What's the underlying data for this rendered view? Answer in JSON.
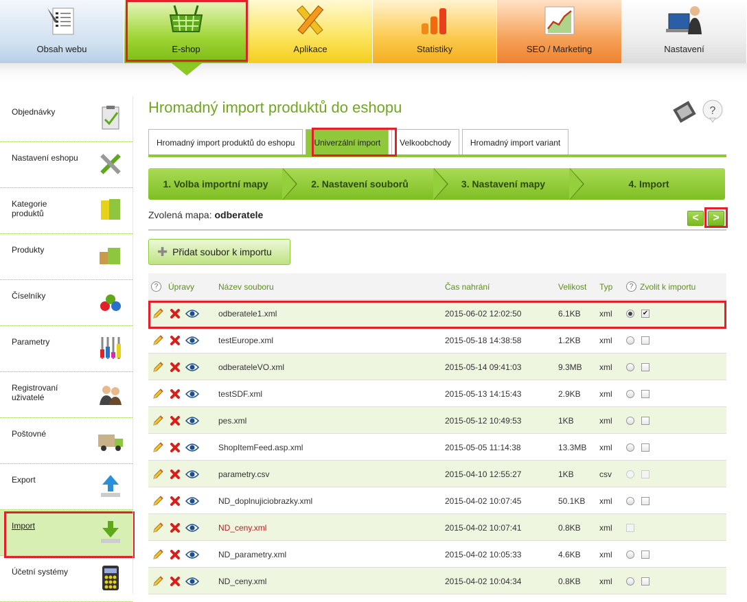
{
  "topnav": {
    "items": [
      {
        "label": "Obsah webu"
      },
      {
        "label": "E-shop"
      },
      {
        "label": "Aplikace"
      },
      {
        "label": "Statistiky"
      },
      {
        "label": "SEO / Marketing"
      },
      {
        "label": "Nastavení"
      }
    ]
  },
  "sidebar": {
    "items": [
      {
        "label": "Objednávky"
      },
      {
        "label": "Nastavení eshopu"
      },
      {
        "label": "Kategorie produktů"
      },
      {
        "label": "Produkty"
      },
      {
        "label": "Číselníky"
      },
      {
        "label": "Parametry"
      },
      {
        "label": "Registrovaní uživatelé"
      },
      {
        "label": "Poštovné"
      },
      {
        "label": "Export"
      },
      {
        "label": "Import"
      },
      {
        "label": "Účetní systémy"
      }
    ]
  },
  "main": {
    "title": "Hromadný import produktů do eshopu",
    "help_label": "?",
    "tabs": [
      {
        "label": "Hromadný import produktů do eshopu"
      },
      {
        "label": "Univerzální import"
      },
      {
        "label": "Velkoobchody"
      },
      {
        "label": "Hromadný import variant"
      }
    ],
    "wizard": [
      {
        "label": "1. Volba importní mapy"
      },
      {
        "label": "2. Nastavení souborů"
      },
      {
        "label": "3. Nastavení mapy"
      },
      {
        "label": "4. Import"
      }
    ],
    "chosen_map_label": "Zvolená mapa:",
    "chosen_map_value": "odberatele",
    "prev_label": "<",
    "next_label": ">",
    "add_button_label": "Přidat soubor k importu"
  },
  "table": {
    "headers": {
      "actions": "Úpravy",
      "name": "Název souboru",
      "time": "Čas nahrání",
      "size": "Velikost",
      "type": "Typ",
      "select": "Zvolit k importu"
    },
    "rows": [
      {
        "name": "odberatele1.xml",
        "time": "2015-06-02 12:02:50",
        "size": "6.1KB",
        "type": "xml"
      },
      {
        "name": "testEurope.xml",
        "time": "2015-05-18 14:38:58",
        "size": "1.2KB",
        "type": "xml"
      },
      {
        "name": "odberateleVO.xml",
        "time": "2015-05-14 09:41:03",
        "size": "9.3MB",
        "type": "xml"
      },
      {
        "name": "testSDF.xml",
        "time": "2015-05-13 14:15:43",
        "size": "2.9KB",
        "type": "xml"
      },
      {
        "name": "pes.xml",
        "time": "2015-05-12 10:49:53",
        "size": "1KB",
        "type": "xml"
      },
      {
        "name": "ShopItemFeed.asp.xml",
        "time": "2015-05-05 11:14:38",
        "size": "13.3MB",
        "type": "xml"
      },
      {
        "name": "parametry.csv",
        "time": "2015-04-10 12:55:27",
        "size": "1KB",
        "type": "csv"
      },
      {
        "name": "ND_doplnujiciobrazky.xml",
        "time": "2015-04-02 10:07:45",
        "size": "50.1KB",
        "type": "xml"
      },
      {
        "name": "ND_ceny.xml",
        "time": "2015-04-02 10:07:41",
        "size": "0.8KB",
        "type": "xml"
      },
      {
        "name": "ND_parametry.xml",
        "time": "2015-04-02 10:05:33",
        "size": "4.6KB",
        "type": "xml"
      },
      {
        "name": "ND_ceny.xml",
        "time": "2015-04-02 10:04:34",
        "size": "0.8KB",
        "type": "xml"
      }
    ]
  },
  "colors": {
    "accent_green": "#8fc83a",
    "highlight_red": "#e3202a",
    "title_green": "#6fa81e",
    "row_odd": "#eef6e0"
  }
}
